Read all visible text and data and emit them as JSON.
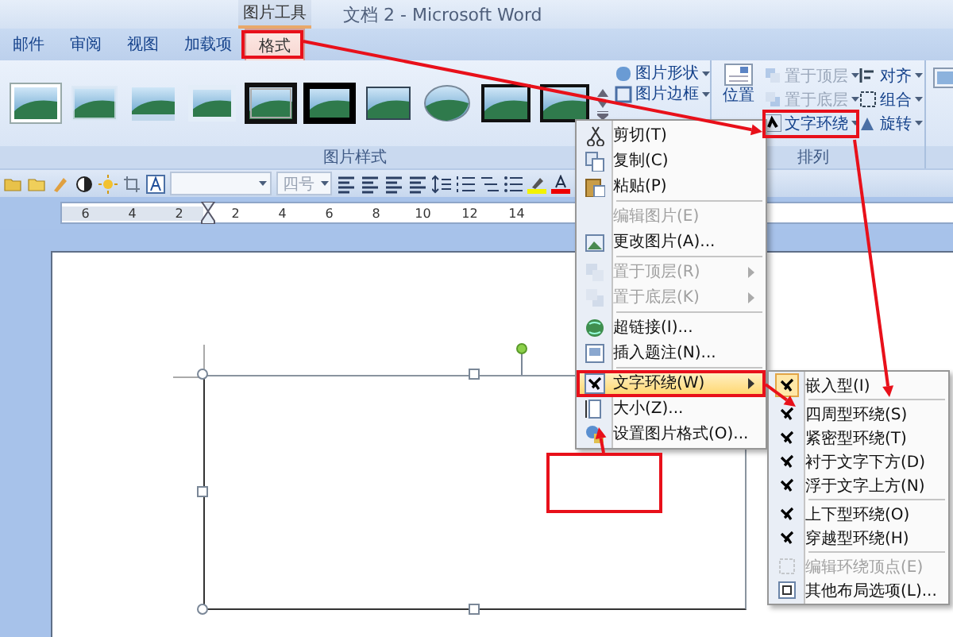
{
  "title_bar": {
    "context_tab": "图片工具",
    "title": "文档 2 - Microsoft Word"
  },
  "tabs": [
    {
      "label": "邮件",
      "selected": false
    },
    {
      "label": "审阅",
      "selected": false
    },
    {
      "label": "视图",
      "selected": false
    },
    {
      "label": "加载项",
      "selected": false
    },
    {
      "label": "格式",
      "selected": true
    }
  ],
  "ribbon": {
    "picture_styles": {
      "commands": [
        {
          "label": "图片形状"
        },
        {
          "label": "图片边框"
        }
      ],
      "group_label": "图片样式"
    },
    "arrange": {
      "position": "位置",
      "commands": [
        {
          "label": "置于顶层",
          "disabled": true
        },
        {
          "label": "置于底层",
          "disabled": true
        },
        {
          "label": "文字环绕",
          "disabled": false
        },
        {
          "label": "对齐",
          "disabled": false
        },
        {
          "label": "组合",
          "disabled": false
        },
        {
          "label": "旋转",
          "disabled": false
        }
      ],
      "group_label": "排列"
    }
  },
  "format_toolbar": {
    "font_size": "四号"
  },
  "ruler": {
    "numbers": [
      "6",
      "4",
      "2",
      "2",
      "4",
      "6",
      "8",
      "10",
      "12",
      "14"
    ]
  },
  "context_menu": {
    "items": [
      {
        "label": "剪切(T)",
        "disabled": false,
        "submenu": false,
        "selected": false,
        "group_start": false
      },
      {
        "label": "复制(C)",
        "disabled": false,
        "submenu": false,
        "selected": false,
        "group_start": false
      },
      {
        "label": "粘贴(P)",
        "disabled": false,
        "submenu": false,
        "selected": false,
        "group_start": false
      },
      {
        "label": "编辑图片(E)",
        "disabled": true,
        "submenu": false,
        "selected": false,
        "group_start": true
      },
      {
        "label": "更改图片(A)...",
        "disabled": false,
        "submenu": false,
        "selected": false,
        "group_start": false
      },
      {
        "label": "置于顶层(R)",
        "disabled": true,
        "submenu": true,
        "selected": false,
        "group_start": true
      },
      {
        "label": "置于底层(K)",
        "disabled": true,
        "submenu": true,
        "selected": false,
        "group_start": false
      },
      {
        "label": "超链接(I)...",
        "disabled": false,
        "submenu": false,
        "selected": false,
        "group_start": true
      },
      {
        "label": "插入题注(N)...",
        "disabled": false,
        "submenu": false,
        "selected": false,
        "group_start": false
      },
      {
        "label": "文字环绕(W)",
        "disabled": false,
        "submenu": true,
        "selected": true,
        "group_start": true
      },
      {
        "label": "大小(Z)...",
        "disabled": false,
        "submenu": false,
        "selected": false,
        "group_start": false
      },
      {
        "label": "设置图片格式(O)...",
        "disabled": false,
        "submenu": false,
        "selected": false,
        "group_start": false
      }
    ]
  },
  "wrap_submenu": {
    "items": [
      {
        "label": "嵌入型(I)",
        "disabled": false,
        "checked": true,
        "group_start": false
      },
      {
        "label": "四周型环绕(S)",
        "disabled": false,
        "checked": false,
        "group_start": true
      },
      {
        "label": "紧密型环绕(T)",
        "disabled": false,
        "checked": false,
        "group_start": false
      },
      {
        "label": "衬于文字下方(D)",
        "disabled": false,
        "checked": false,
        "group_start": false
      },
      {
        "label": "浮于文字上方(N)",
        "disabled": false,
        "checked": false,
        "group_start": false
      },
      {
        "label": "上下型环绕(O)",
        "disabled": false,
        "checked": false,
        "group_start": true
      },
      {
        "label": "穿越型环绕(H)",
        "disabled": false,
        "checked": false,
        "group_start": false
      },
      {
        "label": "编辑环绕顶点(E)",
        "disabled": true,
        "checked": false,
        "group_start": true
      },
      {
        "label": "其他布局选项(L)...",
        "disabled": false,
        "checked": false,
        "group_start": false
      }
    ]
  }
}
